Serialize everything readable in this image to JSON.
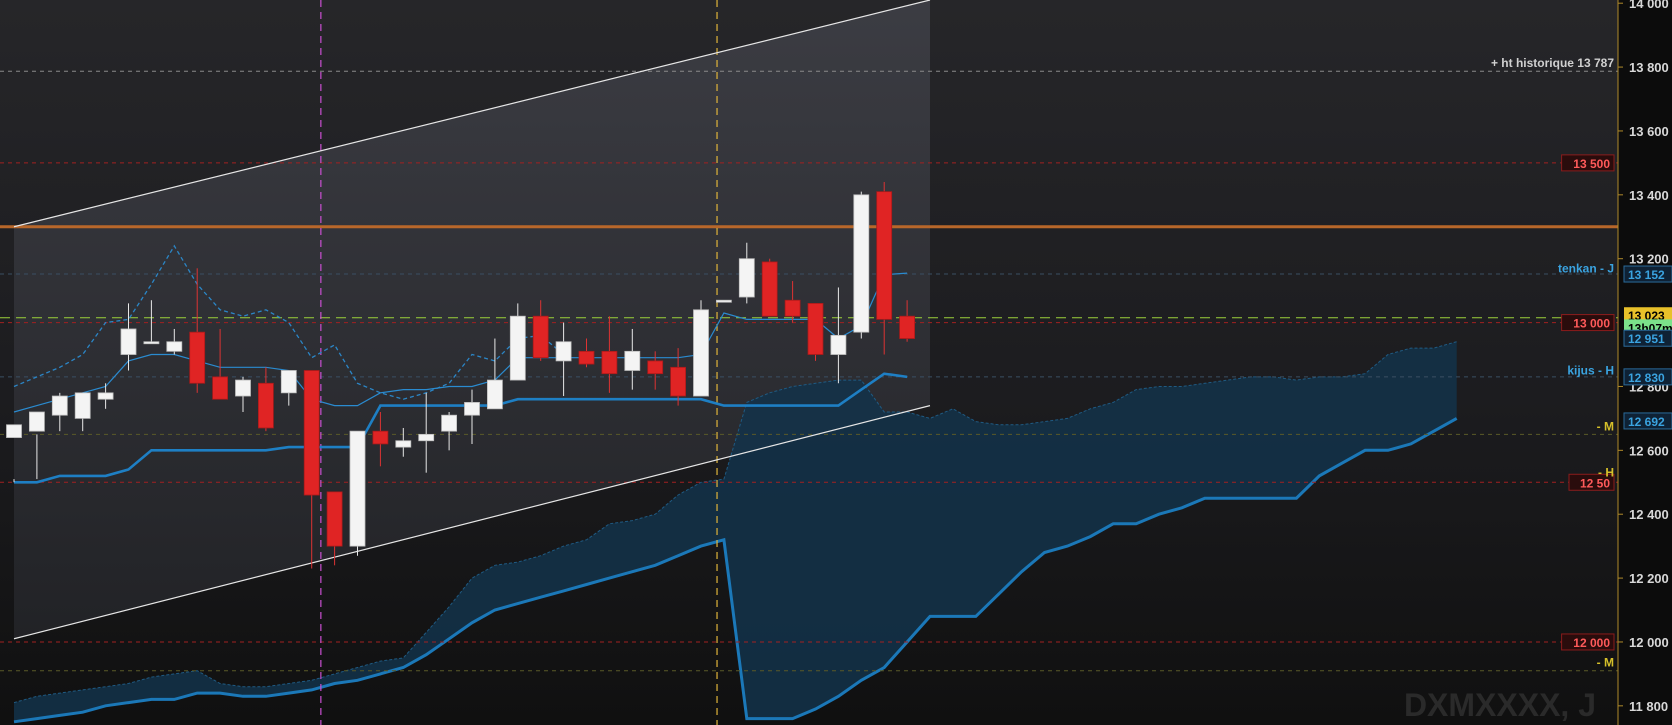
{
  "chart_data": {
    "type": "candlestick",
    "watermark": "DXMXXXX, J",
    "ylim": [
      11740,
      14010
    ],
    "y_ticks": [
      {
        "value": 14000,
        "label": "14 000"
      },
      {
        "value": 13800,
        "label": "13 800"
      },
      {
        "value": 13600,
        "label": "13 600"
      },
      {
        "value": 13400,
        "label": "13 400"
      },
      {
        "value": 13200,
        "label": "13 200"
      },
      {
        "value": 12800,
        "label": "12 800"
      },
      {
        "value": 12600,
        "label": "12 600"
      },
      {
        "value": 12400,
        "label": "12 400"
      },
      {
        "value": 12200,
        "label": "12 200"
      },
      {
        "value": 12000,
        "label": "12 000"
      },
      {
        "value": 11800,
        "label": "11 800"
      }
    ],
    "candles": [
      [
        12640,
        12680,
        12500,
        12510
      ],
      [
        12660,
        12720,
        12510,
        12650
      ],
      [
        12710,
        12770,
        12660,
        12780
      ],
      [
        12700,
        12780,
        12660,
        12770
      ],
      [
        12760,
        12780,
        12730,
        12810
      ],
      [
        12900,
        12980,
        12850,
        13060
      ],
      [
        12940,
        12940,
        12940,
        13070
      ],
      [
        12910,
        12940,
        12900,
        12980
      ],
      [
        12970,
        12810,
        12780,
        13170
      ],
      [
        12830,
        12760,
        12760,
        12980
      ],
      [
        12770,
        12820,
        12720,
        12830
      ],
      [
        12810,
        12670,
        12660,
        12860
      ],
      [
        12780,
        12850,
        12740,
        12850
      ],
      [
        12850,
        12460,
        12230,
        12850
      ],
      [
        12470,
        12300,
        12240,
        12470
      ],
      [
        12300,
        12660,
        12270,
        12660
      ],
      [
        12660,
        12620,
        12550,
        12720
      ],
      [
        12610,
        12630,
        12580,
        12670
      ],
      [
        12630,
        12650,
        12530,
        12780
      ],
      [
        12660,
        12710,
        12600,
        12720
      ],
      [
        12710,
        12750,
        12620,
        12790
      ],
      [
        12730,
        12820,
        12740,
        12950
      ],
      [
        12820,
        13020,
        12850,
        13060
      ],
      [
        13020,
        12890,
        12880,
        13070
      ],
      [
        12880,
        12940,
        12770,
        13000
      ],
      [
        12910,
        12870,
        12860,
        12950
      ],
      [
        12910,
        12840,
        12780,
        13020
      ],
      [
        12850,
        12910,
        12790,
        12980
      ],
      [
        12880,
        12840,
        12790,
        12910
      ],
      [
        12860,
        12770,
        12740,
        12920
      ],
      [
        12770,
        13040,
        12770,
        13070
      ],
      [
        13070,
        13070,
        13070,
        13070
      ],
      [
        13080,
        13200,
        13060,
        13250
      ],
      [
        13190,
        13020,
        13020,
        13200
      ],
      [
        13070,
        13020,
        13000,
        13130
      ],
      [
        13060,
        12900,
        12880,
        13060
      ],
      [
        12900,
        12960,
        12810,
        13110
      ],
      [
        12970,
        13400,
        12950,
        13410
      ],
      [
        13410,
        13010,
        12900,
        13440
      ],
      [
        13020,
        12950,
        12940,
        13070
      ]
    ],
    "tenkan": [
      12720,
      12740,
      12760,
      12780,
      12800,
      12880,
      12900,
      12900,
      12880,
      12860,
      12860,
      12860,
      12850,
      12760,
      12740,
      12740,
      12780,
      12790,
      12790,
      12800,
      12800,
      12820,
      12890,
      12890,
      12890,
      12890,
      12890,
      12890,
      12890,
      12890,
      12900,
      13030,
      13010,
      13010,
      13010,
      13010,
      12950,
      12990,
      13150,
      13155
    ],
    "kijun": [
      12500,
      12500,
      12520,
      12520,
      12520,
      12540,
      12600,
      12600,
      12600,
      12600,
      12600,
      12600,
      12610,
      12610,
      12610,
      12610,
      12740,
      12740,
      12740,
      12740,
      12740,
      12740,
      12760,
      12760,
      12760,
      12760,
      12760,
      12760,
      12760,
      12760,
      12760,
      12740,
      12740,
      12740,
      12740,
      12740,
      12740,
      12790,
      12840,
      12830
    ],
    "lagging_span": [
      12800,
      12830,
      12860,
      12900,
      13000,
      13010,
      13120,
      13240,
      13120,
      13040,
      13020,
      13040,
      13000,
      12890,
      12930,
      12810,
      12780,
      12760,
      12780,
      12810,
      12900,
      12880,
      12950,
      12960,
      12900
    ],
    "cloud_upper": [
      11810,
      11830,
      11840,
      11850,
      11860,
      11870,
      11890,
      11900,
      11910,
      11870,
      11860,
      11860,
      11870,
      11880,
      11900,
      11920,
      11940,
      11950,
      12030,
      12110,
      12200,
      12240,
      12250,
      12270,
      12300,
      12320,
      12370,
      12380,
      12400,
      12460,
      12500,
      12510,
      12750,
      12780,
      12800,
      12810,
      12820,
      12820,
      12720,
      12720,
      12700,
      12730,
      12690,
      12680,
      12680,
      12690,
      12700,
      12730,
      12750,
      12790,
      12800,
      12800,
      12810,
      12820,
      12830,
      12830,
      12820,
      12830,
      12830,
      12840,
      12900,
      12920,
      12920,
      12940
    ],
    "cloud_lower": [
      11750,
      11760,
      11770,
      11780,
      11800,
      11810,
      11820,
      11820,
      11840,
      11840,
      11830,
      11830,
      11840,
      11850,
      11870,
      11880,
      11900,
      11920,
      11960,
      12010,
      12060,
      12100,
      12120,
      12140,
      12160,
      12180,
      12200,
      12220,
      12240,
      12270,
      12300,
      12320,
      11760,
      11760,
      11760,
      11790,
      11830,
      11880,
      11920,
      12000,
      12080,
      12080,
      12080,
      12150,
      12220,
      12280,
      12300,
      12330,
      12370,
      12370,
      12400,
      12420,
      12450,
      12450,
      12450,
      12450,
      12450,
      12520,
      12560,
      12600,
      12600,
      12620,
      12660,
      12700
    ],
    "levels": [
      {
        "value": 13787,
        "style": "dash",
        "color": "#8a8a8a",
        "label": "+ ht historique 13 787",
        "label_color": "#d0d0d0",
        "box": false
      },
      {
        "value": 13500,
        "style": "dash",
        "color": "#a12121",
        "label": "13 500",
        "label_color": "#ff5a5a",
        "box": true
      },
      {
        "value": 13000,
        "style": "dash",
        "color": "#a12121",
        "label": "13 000",
        "label_color": "#ff5a5a",
        "box": true
      },
      {
        "value": 12500,
        "style": "dash",
        "color": "#a12121",
        "label": "12 50",
        "label_color": "#ff5a5a",
        "box": true
      },
      {
        "value": 12000,
        "style": "dash",
        "color": "#a12121",
        "label": "12 000",
        "label_color": "#ff5a5a",
        "box": true
      },
      {
        "value": 13015,
        "style": "longdash",
        "color": "#9bd13a",
        "label": "",
        "label_color": "#9bd13a",
        "box": false
      },
      {
        "value": 13152,
        "style": "dash",
        "color": "#3a4f63",
        "label": "",
        "label_color": "#3aa3e0",
        "box": false
      },
      {
        "value": 12830,
        "style": "dash",
        "color": "#3a4f63",
        "label": "",
        "label_color": "#3aa3e0",
        "box": false
      },
      {
        "value": 12650,
        "style": "dash",
        "color": "#5a5a28",
        "label": "- M",
        "label_color": "#d6c02a",
        "box": false
      },
      {
        "value": 11910,
        "style": "dash",
        "color": "#5a5a28",
        "label": "- M",
        "label_color": "#d6c02a",
        "box": false
      }
    ],
    "resistance": {
      "value": 13300,
      "color": "#b8672a"
    },
    "annotations": [
      {
        "text": "tenkan - J",
        "value": 13170,
        "color": "#3aa3e0"
      },
      {
        "text": "kijus - H",
        "value": 12850,
        "color": "#3aa3e0"
      },
      {
        "text": "- H",
        "value": 12530,
        "color": "#d6c02a"
      }
    ],
    "price_tags": [
      {
        "text": "13 152",
        "value": 13152,
        "bg": "#0f2235",
        "fg": "#3aa3e0"
      },
      {
        "text": "13 023",
        "value": 13023,
        "bg": "#e8c12a",
        "fg": "#000000"
      },
      {
        "text": "13h07m",
        "value": 12985,
        "bg": "#7be28a",
        "fg": "#000000"
      },
      {
        "text": "12 951",
        "value": 12951,
        "bg": "#0f2235",
        "fg": "#3aa3e0"
      },
      {
        "text": "12 830",
        "value": 12830,
        "bg": "#0f2235",
        "fg": "#3aa3e0"
      },
      {
        "text": "12 692",
        "value": 12692,
        "bg": "#0f2235",
        "fg": "#3aa3e0"
      }
    ],
    "channel": {
      "upper": [
        [
          0,
          13300
        ],
        [
          40,
          14010
        ]
      ],
      "lower": [
        [
          0,
          12010
        ],
        [
          40,
          12740
        ]
      ]
    },
    "vlines": [
      {
        "index": 13.4,
        "color": "#c94fd1"
      },
      {
        "index": 30.7,
        "color": "#e0b43a"
      }
    ]
  }
}
